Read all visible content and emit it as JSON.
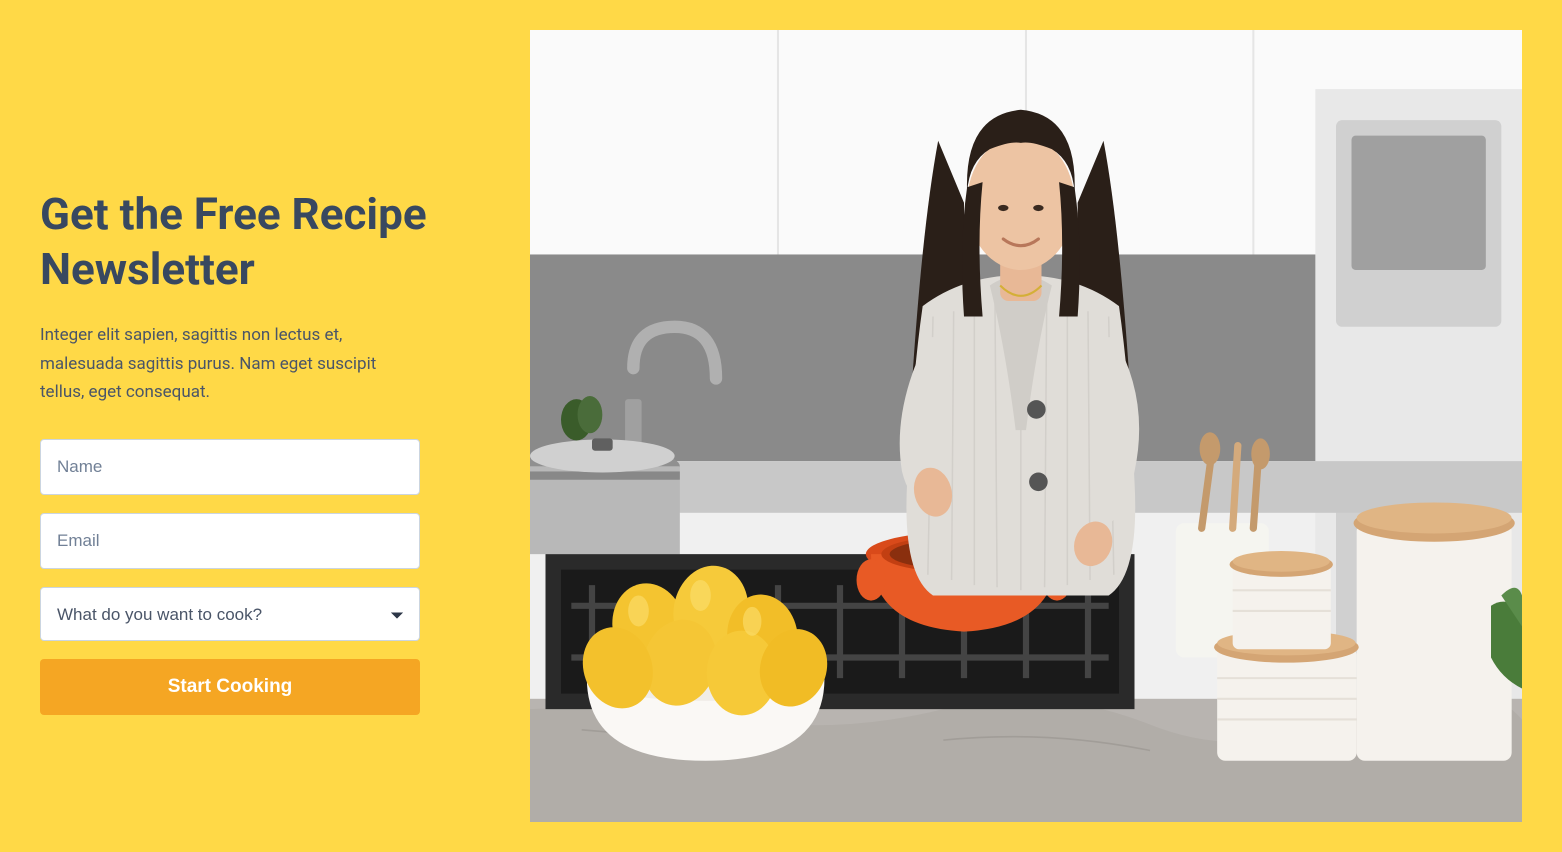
{
  "hero": {
    "heading": "Get the Free Recipe Newsletter",
    "description": "Integer elit sapien, sagittis non lectus et, malesuada sagittis purus. Nam eget suscipit tellus, eget consequat."
  },
  "form": {
    "name_placeholder": "Name",
    "email_placeholder": "Email",
    "select_placeholder": "What do you want to cook?",
    "submit_label": "Start Cooking"
  },
  "colors": {
    "background": "#FFD947",
    "heading": "#384860",
    "button": "#F5A623"
  },
  "image": {
    "alt": "Woman cooking in kitchen with orange pot on stove, lemons in bowl, and white canisters"
  }
}
